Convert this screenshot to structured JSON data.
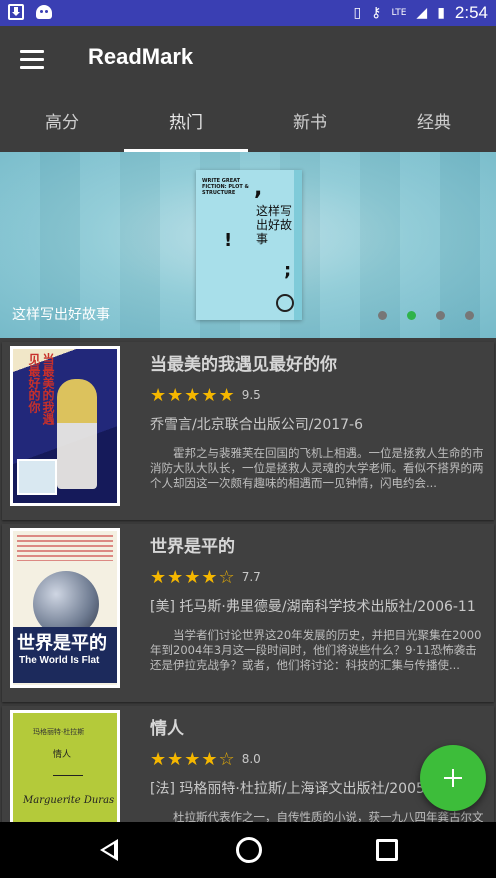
{
  "status_bar": {
    "time": "2:54",
    "network": "LTE"
  },
  "app": {
    "title": "ReadMark"
  },
  "tabs": [
    {
      "label": "高分"
    },
    {
      "label": "热门"
    },
    {
      "label": "新书"
    },
    {
      "label": "经典"
    }
  ],
  "banner": {
    "caption": "这样写出好故事",
    "cover_text_en": "WRITE GREAT FICTION: PLOT & STRUCTURE",
    "cover_text_cn": "这样写出好故事",
    "dots_count": 4,
    "active_dot": 1
  },
  "books": [
    {
      "title": "当最美的我遇见最好的你",
      "stars": "★★★★★",
      "rating": "9.5",
      "meta": "乔雪言/北京联合出版公司/2017-6",
      "summary": "霍邦之与裴雅芙在回国的飞机上相遇。一位是拯救人生命的市消防大队大队长，一位是拯救人灵魂的大学老师。看似不搭界的两个人却因这一次颇有趣味的相遇而一见钟情，闪电约会...",
      "cover_text": "当最美的我遇见最好的你"
    },
    {
      "title": "世界是平的",
      "stars": "★★★★",
      "stars_empty": "☆",
      "rating": "7.7",
      "meta": "[美] 托马斯·弗里德曼/湖南科学技术出版社/2006-11",
      "summary": "当学者们讨论世界这20年发展的历史，并把目光聚集在2000年到2004年3月这一段时间时，他们将说些什么？9·11恐怖袭击还是伊拉克战争？或者，他们将讨论：科技的汇集与传播使...",
      "cover_title": "世界是平的",
      "cover_subtitle": "The World Is Flat"
    },
    {
      "title": "情人",
      "stars": "★★★★",
      "stars_empty": "☆",
      "rating": "8.0",
      "meta": "[法] 玛格丽特·杜拉斯/上海译文出版社/2005",
      "summary": "杜拉斯代表作之一，自传性质的小说，获一九八四年龚古尔文学奖。全书以法国殖民者在越南的生活为背景，描写贫穷的法国少女与富有的中国少爷之间深沉而无望的爱情...",
      "cover_line1": "玛格丽特·杜拉斯",
      "cover_line2": "情人",
      "cover_line3": "Marguerite Duras"
    }
  ],
  "fab": {
    "icon": "plus-icon"
  },
  "nav": {
    "back": "back-icon",
    "home": "home-icon",
    "recent": "recent-apps-icon"
  }
}
